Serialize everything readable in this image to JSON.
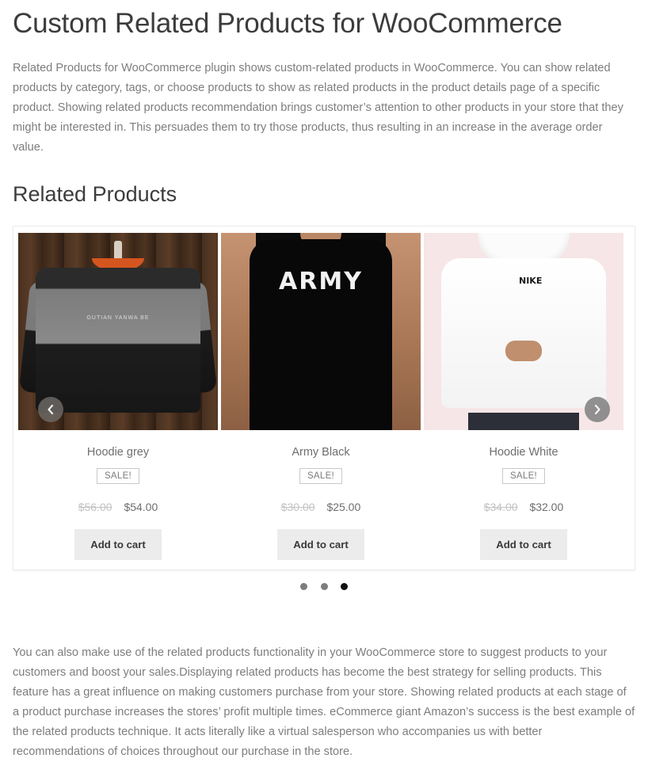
{
  "page": {
    "title": "Custom Related Products for WooCommerce",
    "intro_paragraph": "Related Products for WooCommerce plugin shows custom-related products in WooCommerce. You can show related products by category, tags, or choose products to show as related products in the product details page of a specific product. Showing related products recommendation brings customer’s attention to other products in your store that they might be interested in. This persuades them to try those products, thus resulting in an increase in the average order value.",
    "outro_paragraph": "You can also make use of the related products functionality in your WooCommerce store to suggest products to your customers and boost your sales.Displaying related products has become the best strategy for selling products. This feature has a great influence on making customers purchase from your store. Showing related products at each stage of a product purchase increases the stores’ profit multiple times. eCommerce giant Amazon’s success is the best example of the related products technique. It acts literally like a virtual salesperson who accompanies us with better recommendations of choices throughout our purchase in the store."
  },
  "section": {
    "heading": "Related Products"
  },
  "carousel": {
    "prev_label": "Prev",
    "next_label": "Next",
    "prev_icon": "chevron-left-icon",
    "next_icon": "chevron-right-icon",
    "pagination": {
      "total": 3,
      "active_index": 2,
      "dots": [
        "1",
        "2",
        "3"
      ]
    },
    "products": [
      {
        "name": "Hoodie grey",
        "badge": "SALE!",
        "old_price": "$56.00",
        "new_price": "$54.00",
        "cart_label": "Add to cart",
        "image_alt": "grey-hoodie-on-wooden-background",
        "image_graphic_text": "GUTIAN YANWA BE"
      },
      {
        "name": "Army Black",
        "badge": "SALE!",
        "old_price": "$30.00",
        "new_price": "$25.00",
        "cart_label": "Add to cart",
        "image_alt": "black-army-tshirt-on-model",
        "image_graphic_text": "ARMY"
      },
      {
        "name": "Hoodie White",
        "badge": "SALE!",
        "old_price": "$34.00",
        "new_price": "$32.00",
        "cart_label": "Add to cart",
        "image_alt": "white-hoodie-on-model",
        "image_graphic_text": "NIKE"
      }
    ]
  },
  "colors": {
    "heading": "#3c3c3c",
    "body_text": "#7d7d7d",
    "price_old": "#c2c2c2",
    "price_new": "#6e6e6e",
    "button_bg": "#ececec",
    "dot_active": "#111111",
    "dot_inactive": "#7d7d7d"
  }
}
